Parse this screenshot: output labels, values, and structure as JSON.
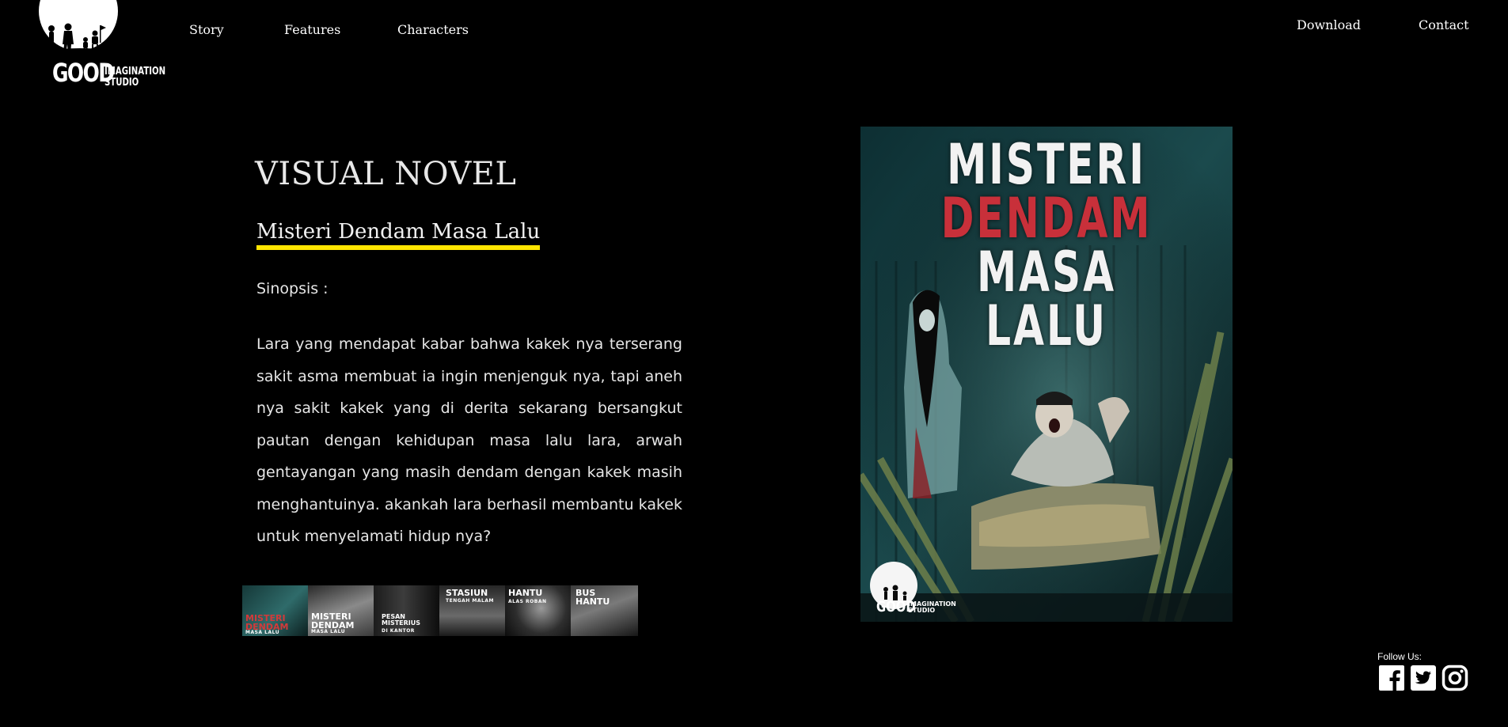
{
  "brand": {
    "logo_word": "GOOD",
    "logo_sub_1": "IMAGINATION",
    "logo_sub_2": "STUDIO"
  },
  "nav": {
    "left": [
      "Story",
      "Features",
      "Characters"
    ],
    "right": [
      "Download",
      "Contact"
    ]
  },
  "main": {
    "kicker": "VISUAL NOVEL",
    "title": "Misteri Dendam Masa Lalu",
    "synopsis_label": "Sinopsis :",
    "synopsis": "Lara yang mendapat kabar bahwa kakek nya terserang sakit asma membuat ia ingin menjenguk nya, tapi aneh nya sakit kakek yang di derita sekarang bersangkut pautan dengan kehidupan masa lalu lara, arwah gentayangan yang masih dendam dengan kakek masih menghantuinya. akankah lara berhasil membantu kakek untuk menyelamati hidup nya?"
  },
  "thumbnails": [
    {
      "label": "MISTERI\nDENDAM",
      "sub": "MASA LALU",
      "accent": "#2f6b6a"
    },
    {
      "label": "MISTERI\nDENDAM",
      "sub": "MASA LALU",
      "accent": "#6c6c6c"
    },
    {
      "label": "PESAN\nMISTERIUS",
      "sub": "DI KANTOR",
      "accent": "#3a3a3a"
    },
    {
      "label": "STASIUN",
      "sub": "TENGAH MALAM",
      "accent": "#555555"
    },
    {
      "label": "HANTU",
      "sub": "ALAS ROBAN",
      "accent": "#4a4a4a"
    },
    {
      "label": "BUS\nHANTU",
      "sub": "",
      "accent": "#5a5a5a"
    }
  ],
  "poster": {
    "line1": "MISTERI",
    "line2": "DENDAM",
    "line3": "MASA LALU",
    "logo_word": "GOOD",
    "logo_sub_1": "IMAGINATION",
    "logo_sub_2": "STUDIO"
  },
  "footer": {
    "follow_label": "Follow Us:",
    "social": [
      "facebook-icon",
      "twitter-icon",
      "instagram-icon"
    ]
  },
  "colors": {
    "background": "#000000",
    "title_underline": "#ffe500",
    "poster_red": "#c8303a"
  }
}
